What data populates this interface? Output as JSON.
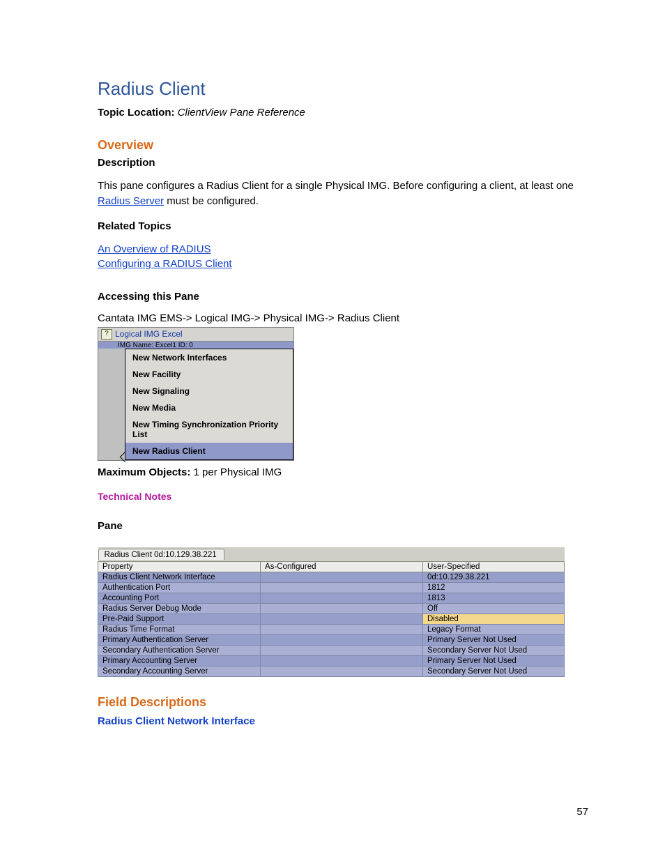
{
  "title": "Radius Client",
  "topic_location_label": "Topic Location: ",
  "topic_location_value": "ClientView Pane Reference",
  "overview_heading": "Overview",
  "description_heading": "Description",
  "description_pre": "This pane configures a Radius Client for a single Physical IMG. Before configuring a client, at least one ",
  "description_link": "Radius Server",
  "description_post": " must be configured.",
  "related_topics_heading": "Related Topics",
  "related_links": {
    "l1": "An Overview of RADIUS",
    "l2": "Configuring a RADIUS Client"
  },
  "accessing_heading": "Accessing this Pane",
  "breadcrumb": "Cantata IMG EMS-> Logical IMG-> Physical IMG-> Radius Client",
  "tree": {
    "root": "Logical IMG Excel",
    "sub": "IMG Name: Excel1  ID: 0",
    "menu": {
      "m1": "New Network Interfaces",
      "m2": "New Facility",
      "m3": "New Signaling",
      "m4": "New Media",
      "m5": "New Timing Synchronization Priority List",
      "m6": "New Radius Client"
    }
  },
  "max_objects_label": "Maximum Objects: ",
  "max_objects_value": "1 per Physical IMG",
  "technical_notes": "Technical Notes",
  "pane_heading": "Pane",
  "pane_tab": "Radius Client 0d:10.129.38.221",
  "pane_headers": {
    "c1": "Property",
    "c2": "As-Configured",
    "c3": "User-Specified"
  },
  "pane_rows": {
    "r1p": "Radius Client Network Interface",
    "r1v": "0d:10.129.38.221",
    "r2p": "Authentication Port",
    "r2v": "1812",
    "r3p": "Accounting Port",
    "r3v": "1813",
    "r4p": "Radius Server Debug Mode",
    "r4v": "Off",
    "r5p": "Pre-Paid Support",
    "r5v": "Disabled",
    "r6p": "Radius Time Format",
    "r6v": "Legacy Format",
    "r7p": "Primary Authentication Server",
    "r7v": "Primary Server Not Used",
    "r8p": "Secondary Authentication Server",
    "r8v": "Secondary Server Not Used",
    "r9p": "Primary Accounting Server",
    "r9v": "Primary Server Not Used",
    "r10p": "Secondary Accounting Server",
    "r10v": "Secondary Server Not Used"
  },
  "field_descriptions_heading": "Field Descriptions",
  "field_desc_sub": "Radius Client Network Interface",
  "page_number": "57"
}
